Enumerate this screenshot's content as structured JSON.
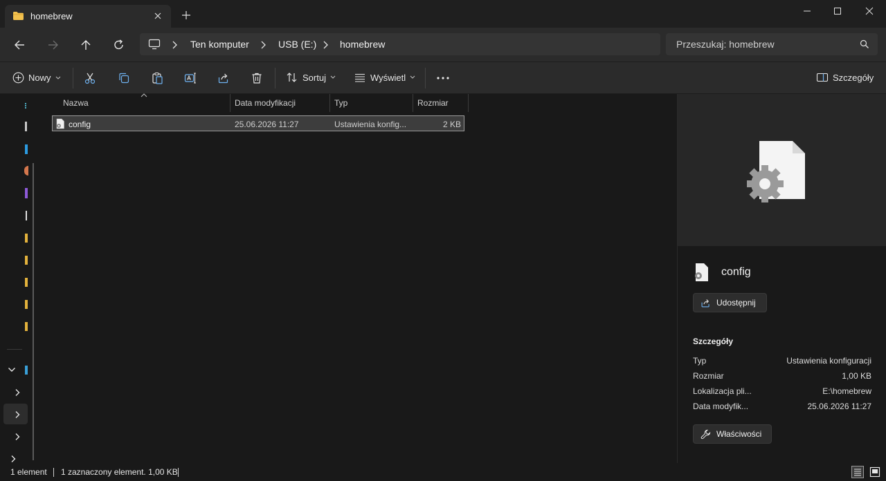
{
  "window": {
    "tab_title": "homebrew",
    "new_tab_symbol": "+"
  },
  "address": {
    "crumbs": [
      "Ten komputer",
      "USB (E:)",
      "homebrew"
    ]
  },
  "search": {
    "placeholder": "Przeszukaj: homebrew"
  },
  "toolbar": {
    "new_label": "Nowy",
    "sort_label": "Sortuj",
    "view_label": "Wyświetl",
    "details_label": "Szczegóły"
  },
  "columns": {
    "name": "Nazwa",
    "modified": "Data modyfikacji",
    "type": "Typ",
    "size": "Rozmiar"
  },
  "files": [
    {
      "name": "config",
      "modified": "25.06.2026 11:27",
      "type": "Ustawienia konfig...",
      "size": "2 KB"
    }
  ],
  "details_pane": {
    "file_name": "config",
    "share_label": "Udostępnij",
    "section_title": "Szczegóły",
    "properties": [
      {
        "key": "Typ",
        "value": "Ustawienia konfiguracji"
      },
      {
        "key": "Rozmiar",
        "value": "1,00 KB"
      },
      {
        "key": "Lokalizacja pli...",
        "value": "E:\\homebrew"
      },
      {
        "key": "Data modyfik...",
        "value": "25.06.2026 11:27"
      }
    ],
    "properties_label": "Właściwości"
  },
  "statusbar": {
    "count": "1 element",
    "selection": "1 zaznaczony element. 1,00 KB"
  },
  "colors": {
    "accent_folder": "#f2c14e",
    "background": "#191919",
    "toolbar": "#2b2b2b"
  }
}
